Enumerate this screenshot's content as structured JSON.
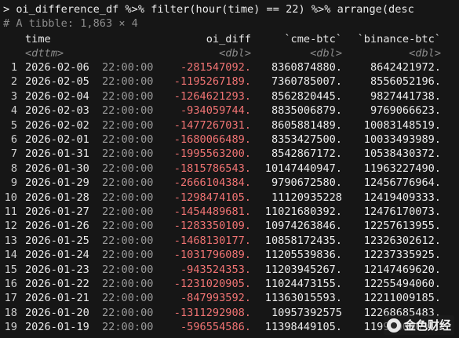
{
  "console": {
    "command": "> oi_difference_df %>% filter(hour(time) == 22) %>% arrange(desc",
    "tibble_comment": "# A tibble: 1,863 × 4"
  },
  "table": {
    "headers": [
      "time",
      "oi_diff",
      "`cme-btc`",
      "`binance-btc`"
    ],
    "types": [
      "<dttm>",
      "<dbl>",
      "<dbl>",
      "<dbl>"
    ],
    "rows": [
      {
        "n": "1",
        "date": "2026-02-06",
        "time": "22:00:00",
        "oi_diff": "-281547092.",
        "cme": "8360874880.",
        "binance": "8642421972."
      },
      {
        "n": "2",
        "date": "2026-02-05",
        "time": "22:00:00",
        "oi_diff": "-1195267189.",
        "cme": "7360785007.",
        "binance": "8556052196."
      },
      {
        "n": "3",
        "date": "2026-02-04",
        "time": "22:00:00",
        "oi_diff": "-1264621293.",
        "cme": "8562820445.",
        "binance": "9827441738."
      },
      {
        "n": "4",
        "date": "2026-02-03",
        "time": "22:00:00",
        "oi_diff": "-934059744.",
        "cme": "8835006879.",
        "binance": "9769066623."
      },
      {
        "n": "5",
        "date": "2026-02-02",
        "time": "22:00:00",
        "oi_diff": "-1477267031.",
        "cme": "8605881489.",
        "binance": "10083148519."
      },
      {
        "n": "6",
        "date": "2026-02-01",
        "time": "22:00:00",
        "oi_diff": "-1680066489.",
        "cme": "8353427500.",
        "binance": "10033493989."
      },
      {
        "n": "7",
        "date": "2026-01-31",
        "time": "22:00:00",
        "oi_diff": "-1995563200.",
        "cme": "8542867172.",
        "binance": "10538430372."
      },
      {
        "n": "8",
        "date": "2026-01-30",
        "time": "22:00:00",
        "oi_diff": "-1815786543.",
        "cme": "10147440947.",
        "binance": "11963227490."
      },
      {
        "n": "9",
        "date": "2026-01-29",
        "time": "22:00:00",
        "oi_diff": "-2666104384.",
        "cme": "9790672580.",
        "binance": "12456776964."
      },
      {
        "n": "10",
        "date": "2026-01-28",
        "time": "22:00:00",
        "oi_diff": "-1298474105.",
        "cme": "11120935228",
        "binance": "12419409333."
      },
      {
        "n": "11",
        "date": "2026-01-27",
        "time": "22:00:00",
        "oi_diff": "-1454489681.",
        "cme": "11021680392.",
        "binance": "12476170073."
      },
      {
        "n": "12",
        "date": "2026-01-26",
        "time": "22:00:00",
        "oi_diff": "-1283350109.",
        "cme": "10974263846.",
        "binance": "12257613955."
      },
      {
        "n": "13",
        "date": "2026-01-25",
        "time": "22:00:00",
        "oi_diff": "-1468130177.",
        "cme": "10858172435.",
        "binance": "12326302612."
      },
      {
        "n": "14",
        "date": "2026-01-24",
        "time": "22:00:00",
        "oi_diff": "-1031796089.",
        "cme": "11205539836.",
        "binance": "12237335925."
      },
      {
        "n": "15",
        "date": "2026-01-23",
        "time": "22:00:00",
        "oi_diff": "-943524353.",
        "cme": "11203945267.",
        "binance": "12147469620."
      },
      {
        "n": "16",
        "date": "2026-01-22",
        "time": "22:00:00",
        "oi_diff": "-1231020905.",
        "cme": "11024473155.",
        "binance": "12255494060."
      },
      {
        "n": "17",
        "date": "2026-01-21",
        "time": "22:00:00",
        "oi_diff": "-847993592.",
        "cme": "11363015593.",
        "binance": "12211009185."
      },
      {
        "n": "18",
        "date": "2026-01-20",
        "time": "22:00:00",
        "oi_diff": "-1311292908.",
        "cme": "10957392575",
        "binance": "12268685483."
      },
      {
        "n": "19",
        "date": "2026-01-19",
        "time": "22:00:00",
        "oi_diff": "-596554586.",
        "cme": "11398449105.",
        "binance": "11995003691."
      }
    ]
  },
  "watermark": {
    "text": "金色财经",
    "icon": "coin-logo-icon"
  },
  "colors": {
    "background": "#161616",
    "negative": "#f07373",
    "dim": "#8a8a8a"
  }
}
